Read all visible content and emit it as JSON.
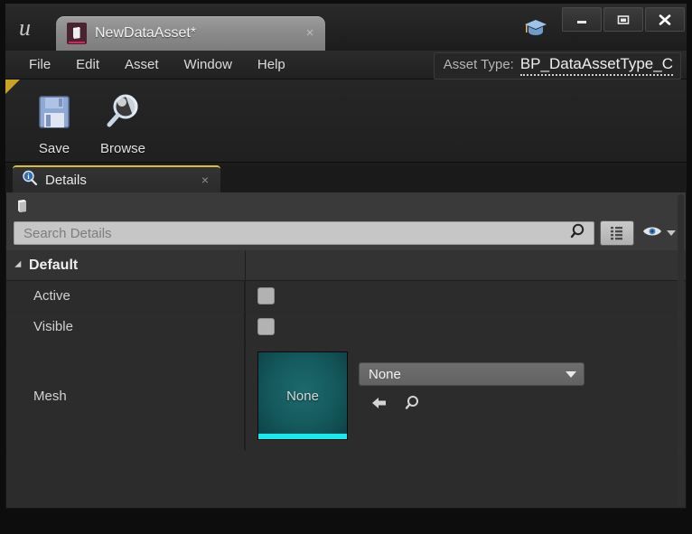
{
  "window": {
    "title_tab": "NewDataAsset*",
    "tab_icon": "data-asset-icon",
    "tab_close": "×",
    "logo": "unreal-engine-logo",
    "tutorial_icon": "graduation-cap-icon",
    "minimize": "minimize-icon",
    "maximize": "maximize-icon",
    "close": "close-icon"
  },
  "menubar": {
    "items": [
      {
        "label": "File"
      },
      {
        "label": "Edit"
      },
      {
        "label": "Asset"
      },
      {
        "label": "Window"
      },
      {
        "label": "Help"
      }
    ],
    "asset_type_label": "Asset Type:",
    "asset_type_value": "BP_DataAssetType_C"
  },
  "toolbar": {
    "buttons": [
      {
        "label": "Save",
        "icon": "floppy-disk-icon"
      },
      {
        "label": "Browse",
        "icon": "magnifier-icon"
      }
    ]
  },
  "details_panel": {
    "tab_label": "Details",
    "tab_icon": "details-info-icon",
    "tab_close": "×",
    "toolrow_icon": "data-asset-small-icon",
    "search": {
      "placeholder": "Search Details",
      "value": "",
      "icon": "search-icon"
    },
    "grid_toggle_icon": "grid-view-icon",
    "eye_icon": "visibility-eye-icon",
    "eye_dropdown_icon": "chevron-down-icon",
    "sections": [
      {
        "title": "Default",
        "expanded": true,
        "properties": [
          {
            "name": "Active",
            "type": "checkbox",
            "checked": false
          },
          {
            "name": "Visible",
            "type": "checkbox",
            "checked": false
          },
          {
            "name": "Mesh",
            "type": "object",
            "thumbnail_label": "None",
            "combo_value": "None",
            "actions": [
              {
                "icon": "use-selected-arrow-icon"
              },
              {
                "icon": "browse-magnifier-icon"
              }
            ]
          }
        ]
      }
    ]
  },
  "colors": {
    "accent_yellow": "#d8bd3a",
    "thumbnail_teal": "#14585c",
    "thumbnail_bar_cyan": "#1ae8ef",
    "asset_icon_pink": "#d6255f",
    "panel_bg": "#2c2c2c",
    "toolbar_corner": "#c9a227"
  }
}
